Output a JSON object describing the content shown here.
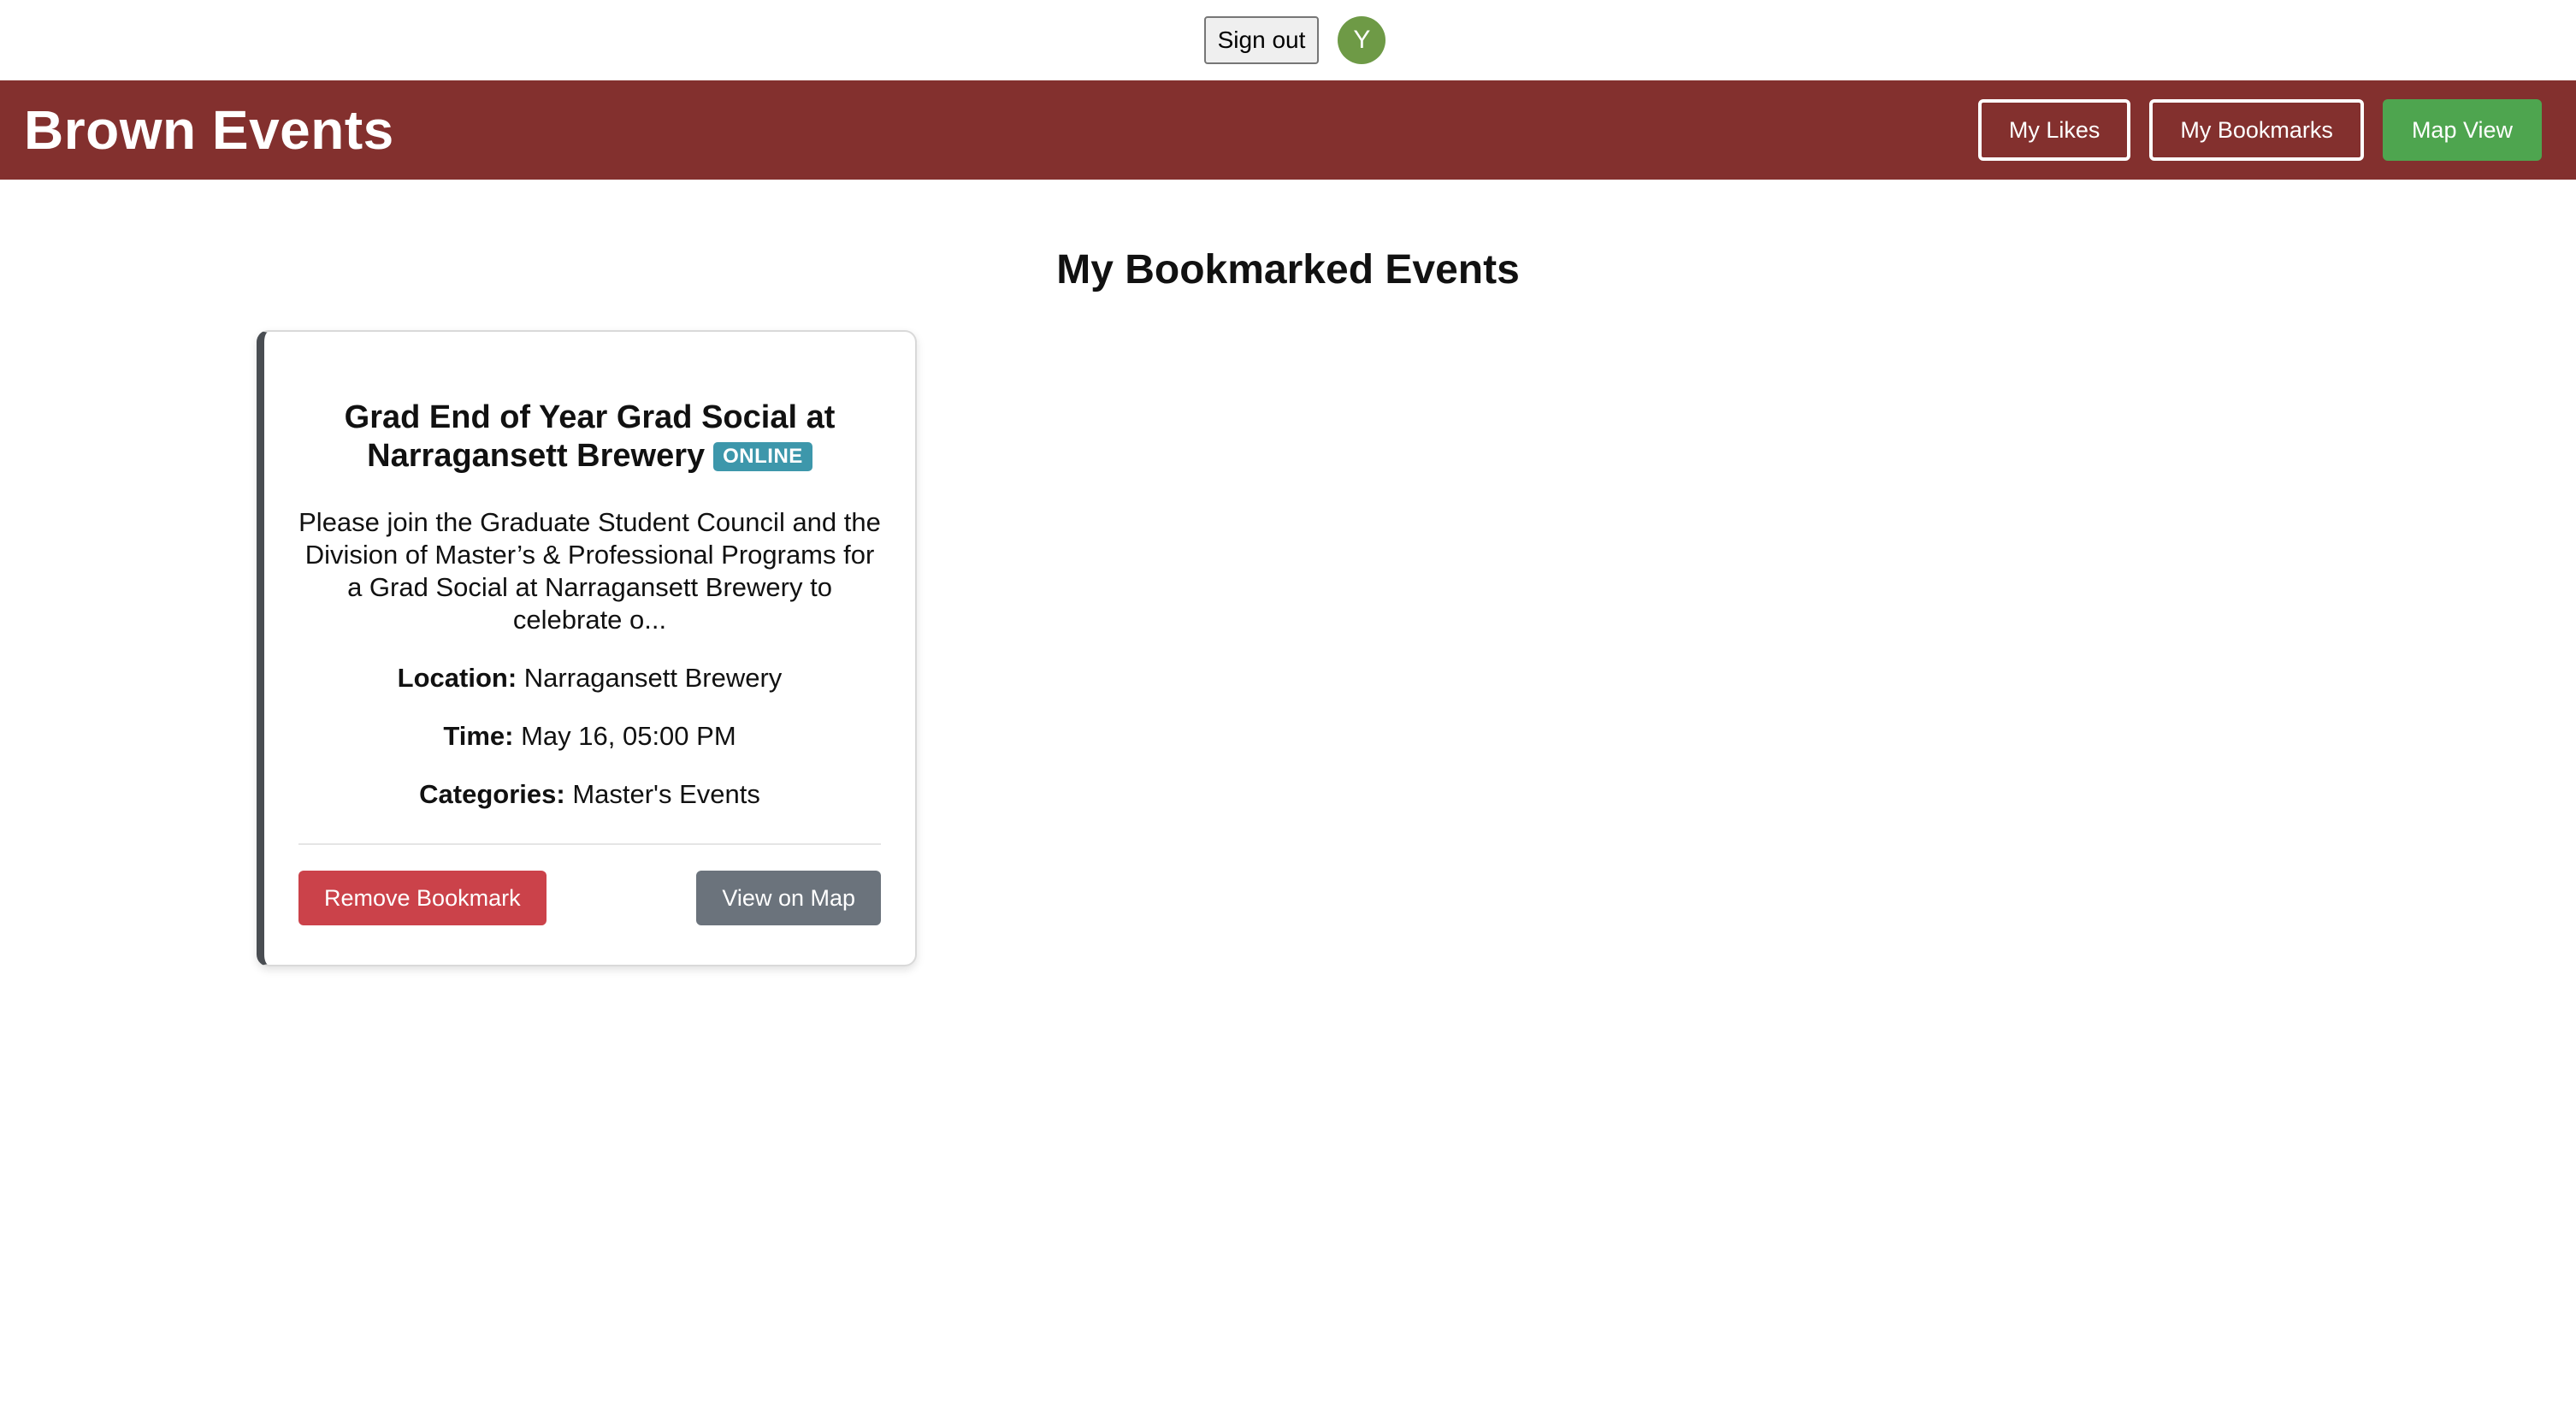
{
  "topbar": {
    "signout_label": "Sign out",
    "avatar_initial": "Y"
  },
  "navbar": {
    "brand": "Brown Events",
    "likes_label": "My Likes",
    "bookmarks_label": "My Bookmarks",
    "map_view_label": "Map View"
  },
  "main": {
    "title": "My Bookmarked Events",
    "events": [
      {
        "title": "Grad End of Year Grad Social at Narragansett Brewery",
        "badge": "ONLINE",
        "description": "Please join the Graduate Student Council and the Division of Master’s & Professional Programs for a Grad Social at Narragansett Brewery to celebrate o...",
        "location_label": "Location:",
        "location": "Narragansett Brewery",
        "time_label": "Time:",
        "time": "May 16, 05:00 PM",
        "categories_label": "Categories:",
        "categories": "Master's Events",
        "remove_label": "Remove Bookmark",
        "map_label": "View on Map"
      }
    ]
  },
  "colors": {
    "navbar": "#83302e",
    "map_view": "#4ea54f",
    "badge": "#3d97ab",
    "remove": "#cb424a",
    "view_map": "#6b737c",
    "avatar": "#6e9a46"
  }
}
